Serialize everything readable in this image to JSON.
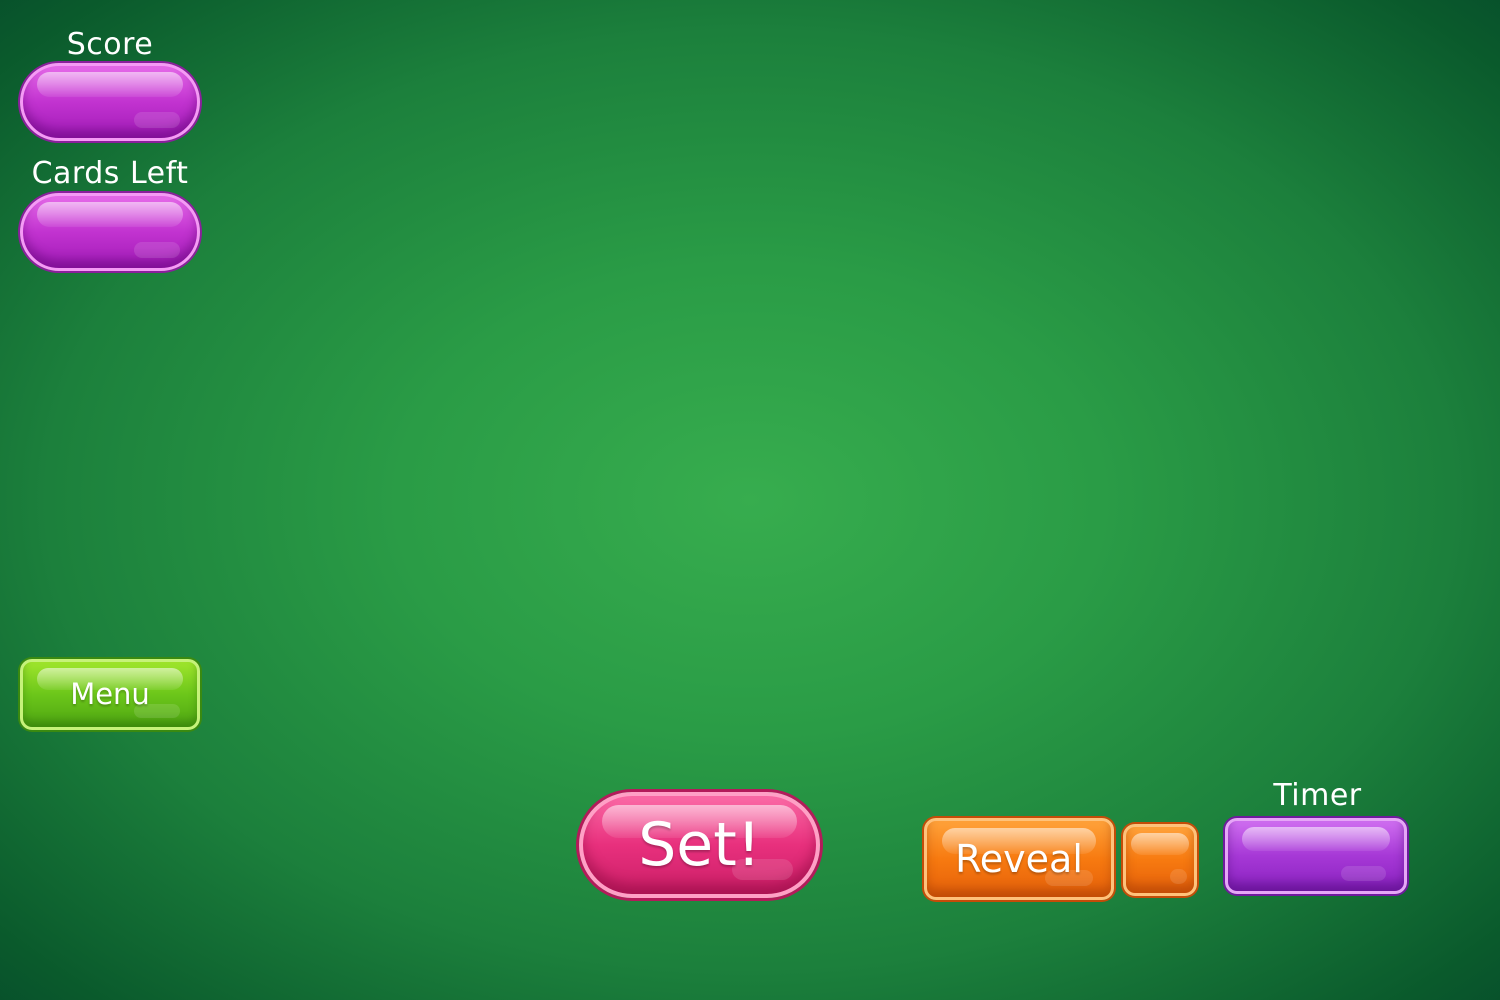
{
  "hud": {
    "score_label": "Score",
    "score_value": "",
    "cards_left_label": "Cards Left",
    "cards_left_value": "",
    "timer_label": "Timer",
    "timer_value": ""
  },
  "controls": {
    "menu_label": "Menu",
    "set_label": "Set!",
    "reveal_label": "Reveal",
    "reveal_count": ""
  },
  "colors": {
    "background": "#2a9c46",
    "hud_pill": "#c233d0",
    "menu_button": "#6cc61a",
    "set_button": "#e8307d",
    "reveal_button": "#f77a10",
    "timer_pill": "#a638d6"
  }
}
